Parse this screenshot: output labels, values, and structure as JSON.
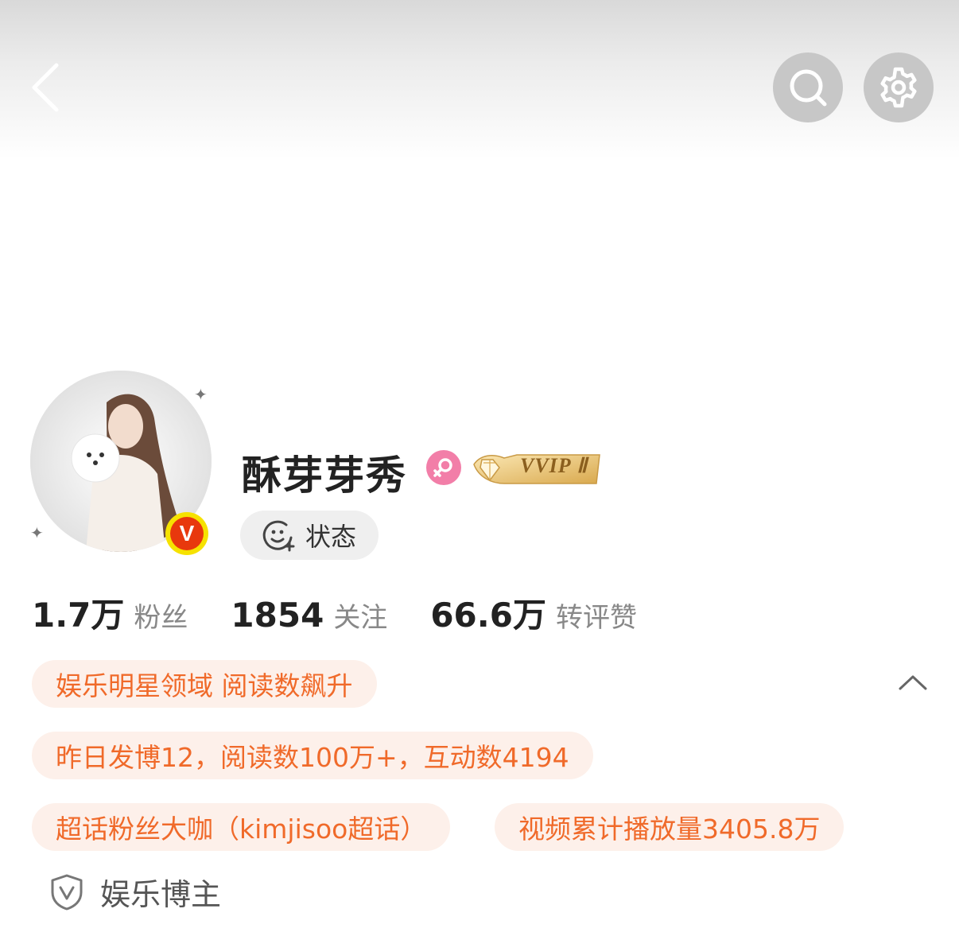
{
  "header": {
    "back_icon": "chevron-left-icon",
    "search_icon": "search-icon",
    "settings_icon": "gear-icon"
  },
  "profile": {
    "name": "酥芽芽秀",
    "gender_icon": "female-icon",
    "vip_badge": "VVIP Ⅱ",
    "verified_icon": "v-verified-icon",
    "status_label": "状态"
  },
  "stats": {
    "followers_value": "1.7万",
    "followers_label": "粉丝",
    "following_value": "1854",
    "following_label": "关注",
    "interactions_value": "66.6万",
    "interactions_label": "转评赞"
  },
  "tags": {
    "domain": "娱乐明星领域 阅读数飙升",
    "yesterday": "昨日发博12，阅读数100万+，互动数4194",
    "supertopic": "超话粉丝大咖（kimjisoo超话）",
    "video": "视频累计播放量3405.8万"
  },
  "role": {
    "label": "娱乐博主",
    "icon": "shield-v-icon"
  },
  "colors": {
    "accent_orange": "#f06a2a",
    "tag_bg": "#fdf0ea",
    "gender_pink": "#f27ea8",
    "verified_red": "#e8380d",
    "verified_yellow": "#f6e200"
  }
}
